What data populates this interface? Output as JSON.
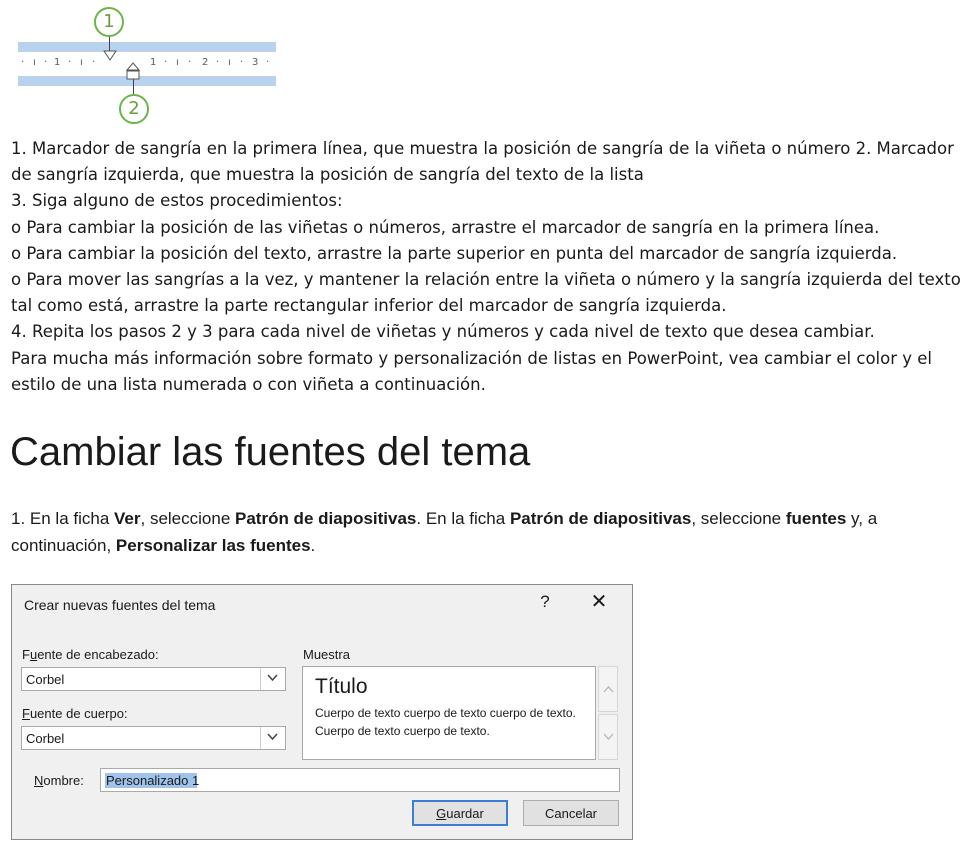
{
  "ruler": {
    "ticks": [
      "·",
      "ı",
      "·",
      "1",
      "·",
      "ı",
      "·",
      "1",
      "·",
      "ı",
      "·",
      "2",
      "·",
      "ı",
      "·",
      "3",
      "·"
    ],
    "callout_first_line": "1",
    "callout_left_indent": "2",
    "colors": {
      "band": "#b9d3ee",
      "callout_ring": "#6bb54a"
    }
  },
  "paragraphs": [
    "1. Marcador de sangría en la primera línea, que muestra la posición de sangría de la viñeta o número 2. Marcador de sangría izquierda, que muestra la posición de sangría del texto de la lista",
    "3. Siga alguno de estos procedimientos:",
    "o Para cambiar la posición de las viñetas o números, arrastre el marcador de sangría en la primera línea.",
    "o Para cambiar la posición del texto, arrastre la parte superior en punta del marcador de sangría izquierda.",
    "o Para mover las sangrías a la vez, y mantener la relación entre la viñeta o número y la sangría izquierda del texto tal como está, arrastre la parte rectangular inferior del marcador de sangría izquierda.",
    "4. Repita los pasos 2 y 3 para cada nivel de viñetas y números y cada nivel de texto que desea cambiar.",
    "Para mucha más información sobre formato y personalización de listas en PowerPoint, vea cambiar el color y el estilo de una lista numerada o con viñeta a continuación."
  ],
  "heading": "Cambiar las fuentes del tema",
  "step1": {
    "t1": "1. En la ficha ",
    "b1": "Ver",
    "t2": ", seleccione ",
    "b2": "Patrón de diapositivas",
    "t3": ". En la ficha ",
    "b3": "Patrón de diapositivas",
    "t4": ", seleccione ",
    "b4": "fuentes",
    "t5": " y, a continuación, ",
    "b5": "Personalizar las fuentes",
    "t6": "."
  },
  "dialog": {
    "title": "Crear nuevas fuentes del tema",
    "help": "?",
    "close": "✕",
    "heading_font_label_pre": "F",
    "heading_font_label_key": "u",
    "heading_font_label_post": "ente de encabezado:",
    "heading_font_value": "Corbel",
    "body_font_label_key": "F",
    "body_font_label_post": "uente de cuerpo:",
    "body_font_value": "Corbel",
    "sample_label": "Muestra",
    "sample_title": "Título",
    "sample_body": "Cuerpo de texto cuerpo de texto cuerpo de texto. Cuerpo de texto cuerpo de texto.",
    "name_label_key": "N",
    "name_label_post": "ombre:",
    "name_value": "Personalizado 1",
    "save_key": "G",
    "save_post": "uardar",
    "cancel": "Cancelar",
    "icons": {
      "dropdown": "chevron-down-icon",
      "scroll_up": "chevron-up-icon",
      "scroll_down": "chevron-down-icon"
    }
  }
}
